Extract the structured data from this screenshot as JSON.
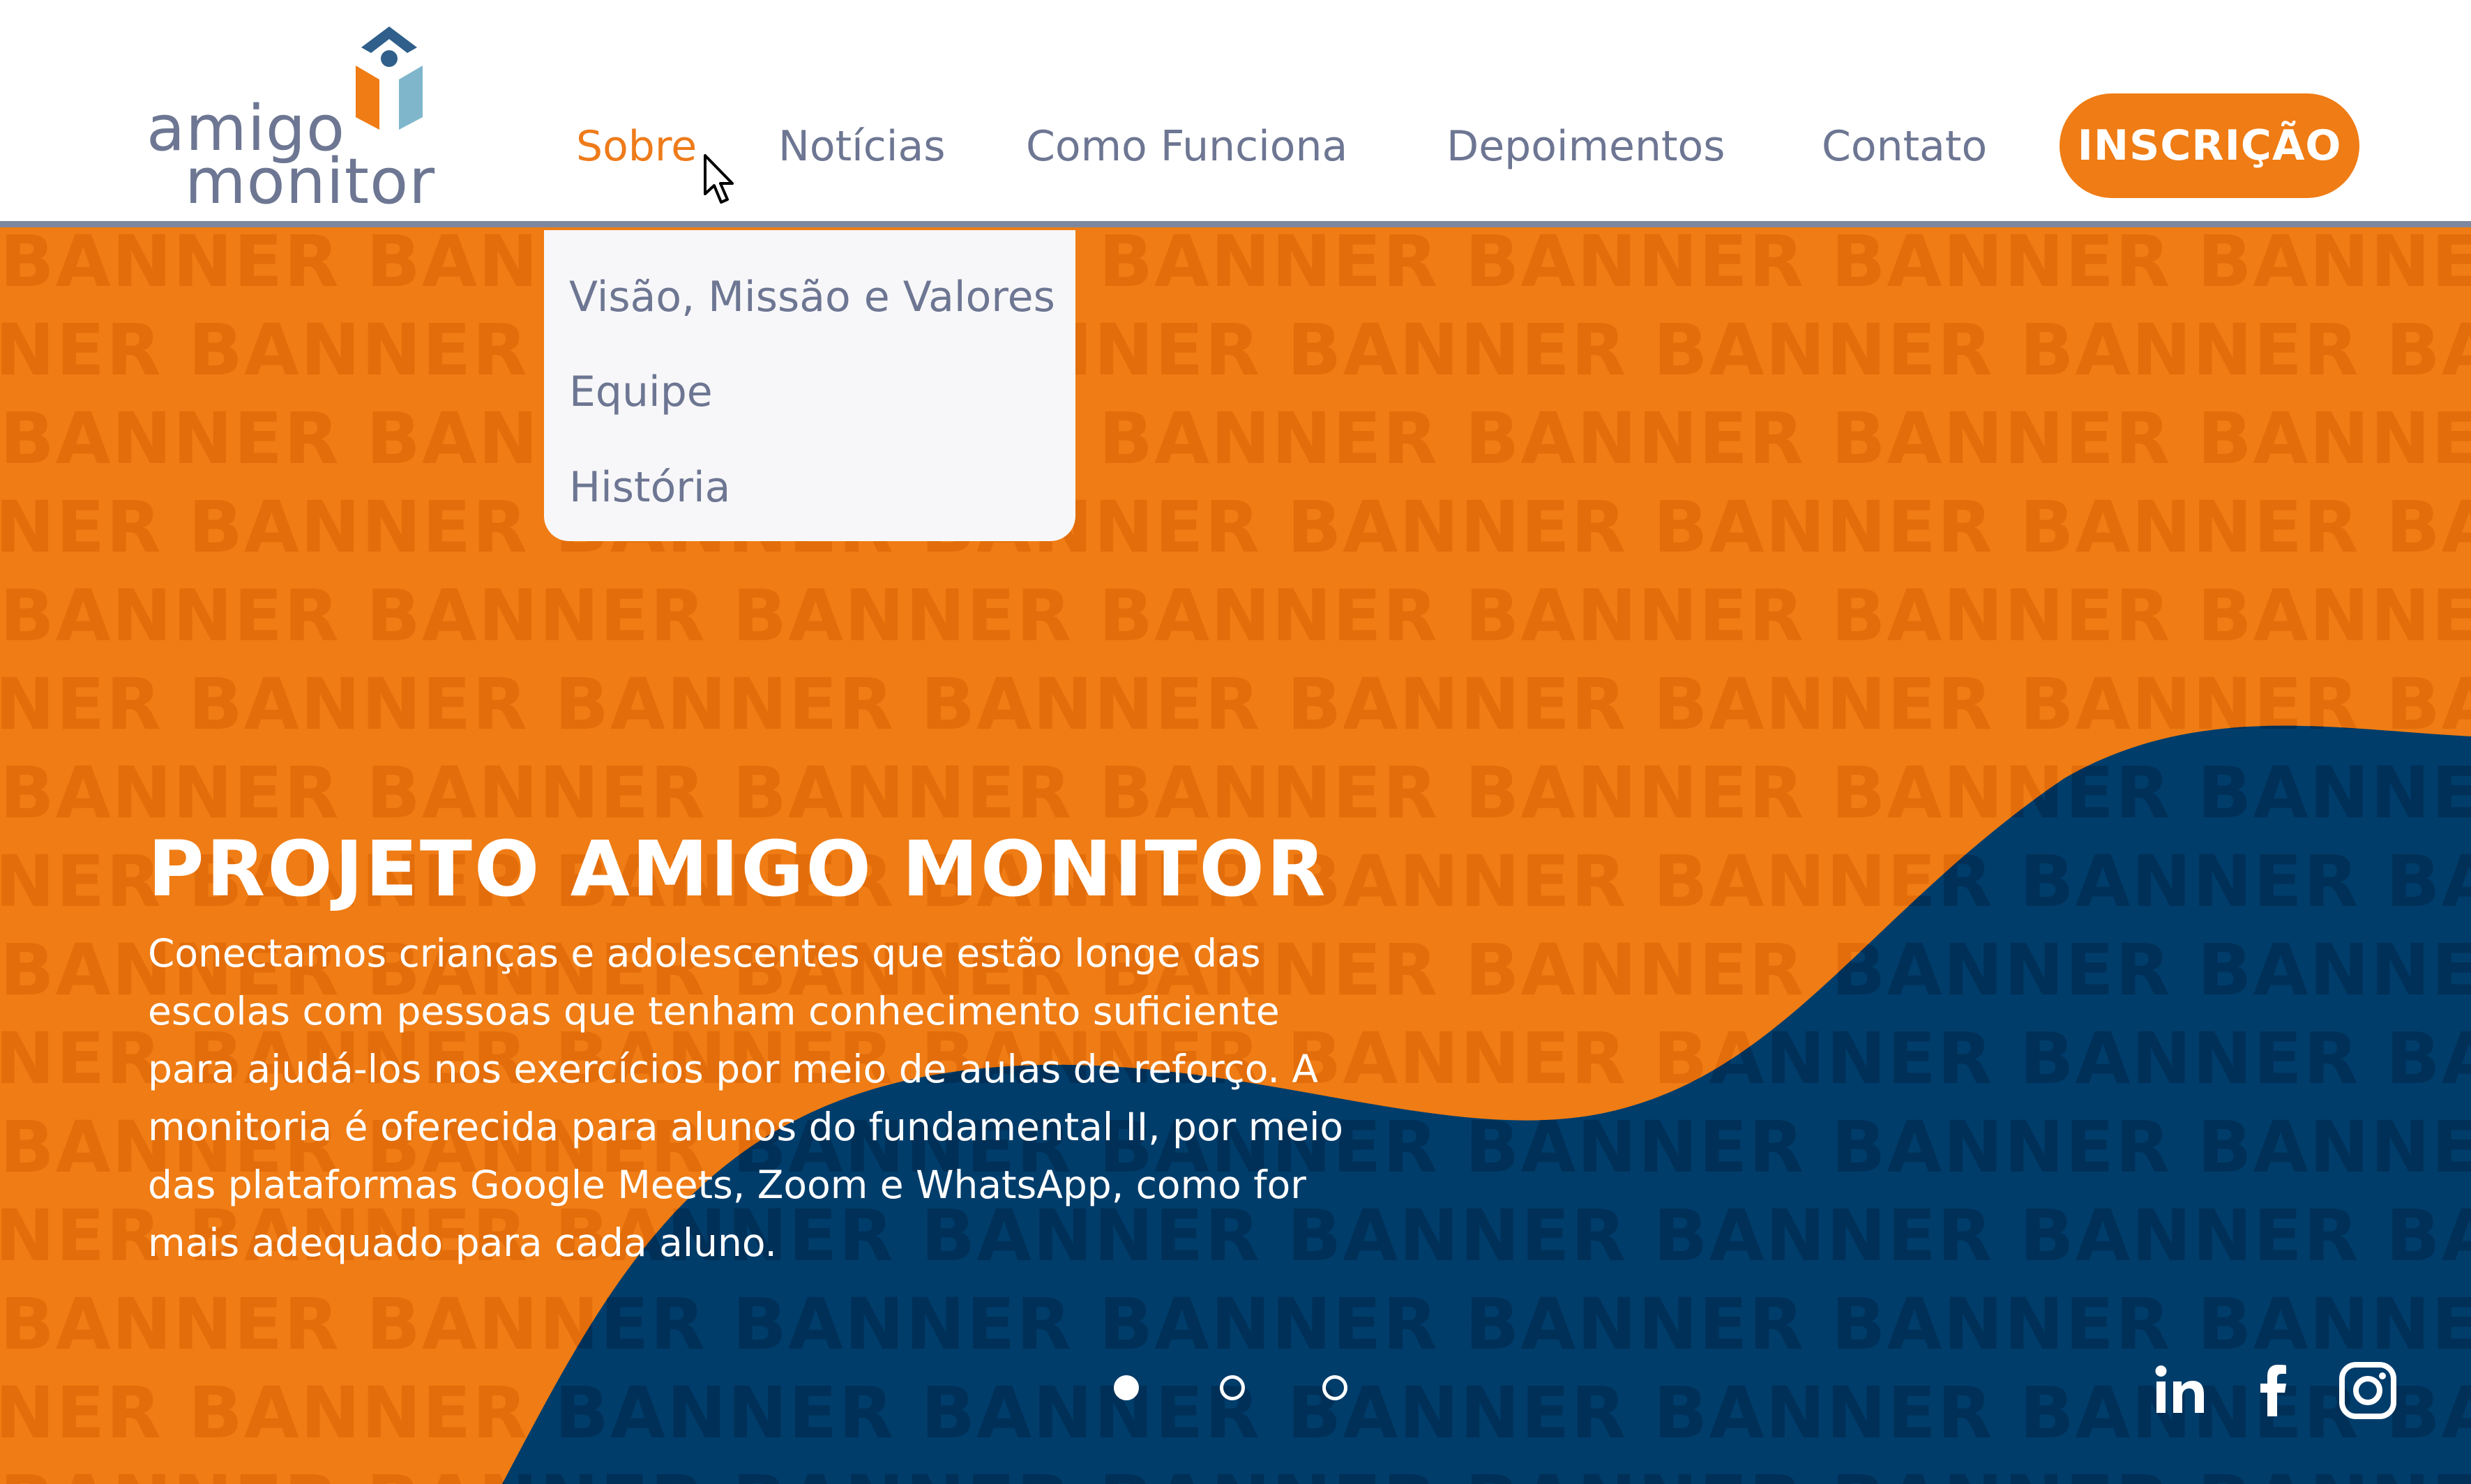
{
  "logo": {
    "line1": "amigo",
    "line2": "monitor",
    "icon": "amigo-monitor-logo-icon"
  },
  "nav": {
    "items": [
      {
        "label": "Sobre",
        "active": true
      },
      {
        "label": "Notícias"
      },
      {
        "label": "Como Funciona"
      },
      {
        "label": "Depoimentos"
      },
      {
        "label": "Contato"
      }
    ],
    "cta_label": "INSCRIÇÃO"
  },
  "dropdown": {
    "items": [
      {
        "label": "Visão, Missão e Valores"
      },
      {
        "label": "Equipe"
      },
      {
        "label": "História"
      }
    ]
  },
  "banner": {
    "pattern_word": "BANNER",
    "title": "PROJETO AMIGO MONITOR",
    "text": "Conectamos crianças e adolescentes que estão longe das escolas com pessoas que tenham conhecimento suficiente para ajudá-los nos exercícios por meio de aulas de reforço. A monitoria é oferecida para alunos do fundamental II, por meio das plataformas Google Meets, Zoom e WhatsApp, como for mais adequado para cada aluno.",
    "slides": [
      {
        "active": true
      },
      {
        "active": false
      },
      {
        "active": false
      }
    ]
  },
  "social": {
    "icons": [
      "linkedin-icon",
      "facebook-icon",
      "instagram-icon"
    ]
  },
  "colors": {
    "orange": "#ef7c14",
    "orange_pattern": "#e26d0a",
    "navy": "#003d6b",
    "navy_pattern": "#003057",
    "gray_text": "#6d7692",
    "logo_blue": "#2f5f8a",
    "logo_light_blue": "#7fb6cc"
  }
}
